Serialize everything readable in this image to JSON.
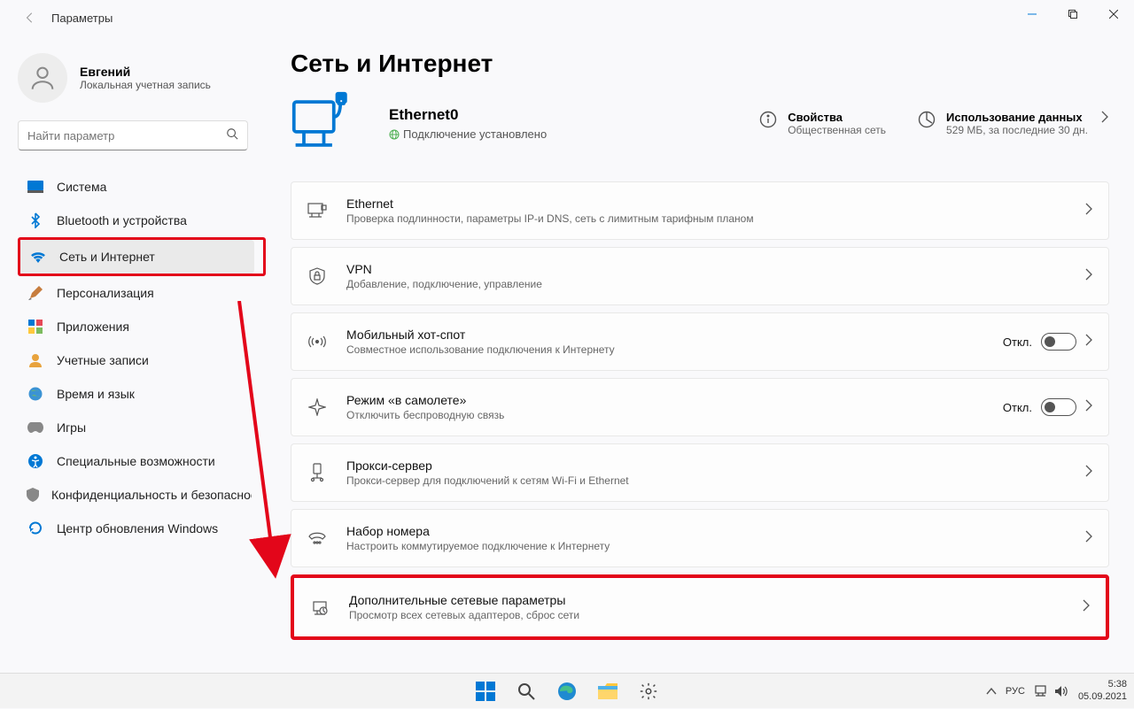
{
  "window": {
    "title": "Параметры"
  },
  "user": {
    "name": "Евгений",
    "account": "Локальная учетная запись"
  },
  "search": {
    "placeholder": "Найти параметр"
  },
  "nav": {
    "system": "Система",
    "bluetooth": "Bluetooth и устройства",
    "network": "Сеть и Интернет",
    "personalization": "Персонализация",
    "apps": "Приложения",
    "accounts": "Учетные записи",
    "time": "Время и язык",
    "gaming": "Игры",
    "accessibility": "Специальные возможности",
    "privacy": "Конфиденциальность и безопасность",
    "update": "Центр обновления Windows"
  },
  "page": {
    "title": "Сеть и Интернет"
  },
  "connection": {
    "name": "Ethernet0",
    "status": "Подключение установлено"
  },
  "props": {
    "title": "Свойства",
    "sub": "Общественная сеть"
  },
  "usage": {
    "title": "Использование данных",
    "sub": "529 МБ, за последние 30 дн."
  },
  "items": {
    "ethernet": {
      "title": "Ethernet",
      "sub": "Проверка подлинности, параметры IP-и DNS, сеть с лимитным тарифным планом"
    },
    "vpn": {
      "title": "VPN",
      "sub": "Добавление, подключение, управление"
    },
    "hotspot": {
      "title": "Мобильный хот-спот",
      "sub": "Совместное использование подключения к Интернету",
      "toggle": "Откл."
    },
    "airplane": {
      "title": "Режим «в самолете»",
      "sub": "Отключить беспроводную связь",
      "toggle": "Откл."
    },
    "proxy": {
      "title": "Прокси-сервер",
      "sub": "Прокси-сервер для подключений к сетям Wi-Fi и Ethernet"
    },
    "dialup": {
      "title": "Набор номера",
      "sub": "Настроить коммутируемое подключение к Интернету"
    },
    "advanced": {
      "title": "Дополнительные сетевые параметры",
      "sub": "Просмотр всех сетевых адаптеров, сброс сети"
    }
  },
  "taskbar": {
    "lang": "РУС",
    "time": "5:38",
    "date": "05.09.2021"
  }
}
